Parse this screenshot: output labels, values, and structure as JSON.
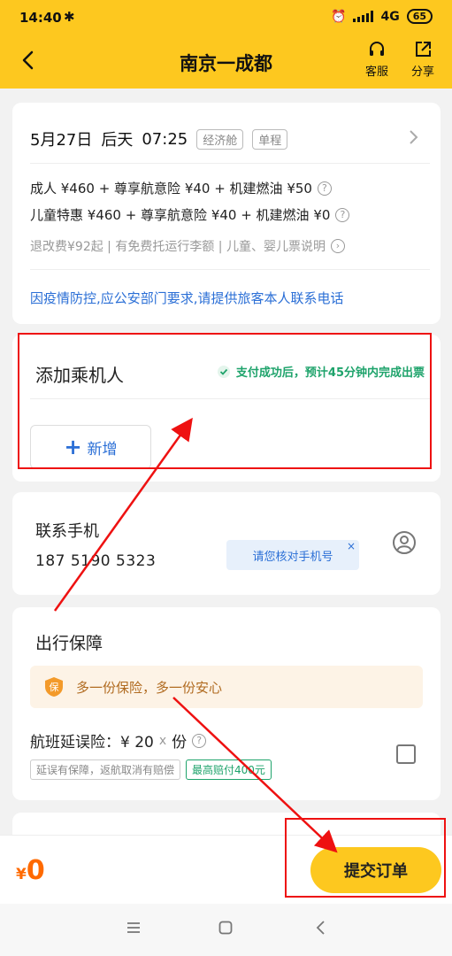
{
  "status": {
    "time": "14:40",
    "network": "4G",
    "battery": "65"
  },
  "nav": {
    "title": "南京一成都",
    "service": "客服",
    "share": "分享"
  },
  "flight": {
    "date": "5月27日",
    "day": "后天",
    "time": "07:25",
    "cabin": "经济舱",
    "trip": "单程",
    "adult_line": "成人 ¥460 + 尊享航意险 ¥40 + 机建燃油 ¥50",
    "child_line": "儿童特惠 ¥460 + 尊享航意险 ¥40 + 机建燃油 ¥0",
    "refund_line": "退改费¥92起 | 有免费托运行李额 | 儿童、婴儿票说明",
    "notice": "因疫情防控,应公安部门要求,请提供旅客本人联系电话"
  },
  "passenger": {
    "title": "添加乘机人",
    "note": "支付成功后，预计45分钟内完成出票",
    "add_label": "新增"
  },
  "contact": {
    "title": "联系手机",
    "phone": "187 5190 5323",
    "tip": "请您核对手机号",
    "tip_close": "×"
  },
  "insurance": {
    "title": "出行保障",
    "banner": "多一份保险，多一份安心",
    "shield_char": "保",
    "delay_label": "航班延误险：¥ 20",
    "delay_x": "x",
    "delay_unit": "份",
    "tag1": "延误有保障，返航取消有赔偿",
    "tag2": "最高赔付400元"
  },
  "bottom": {
    "currency": "¥",
    "amount": "0",
    "submit": "提交订单"
  },
  "colors": {
    "header": "#fdc81f",
    "accent_blue": "#2b6fd6",
    "price_orange": "#ff6a00",
    "annotation_red": "#ee1111"
  }
}
